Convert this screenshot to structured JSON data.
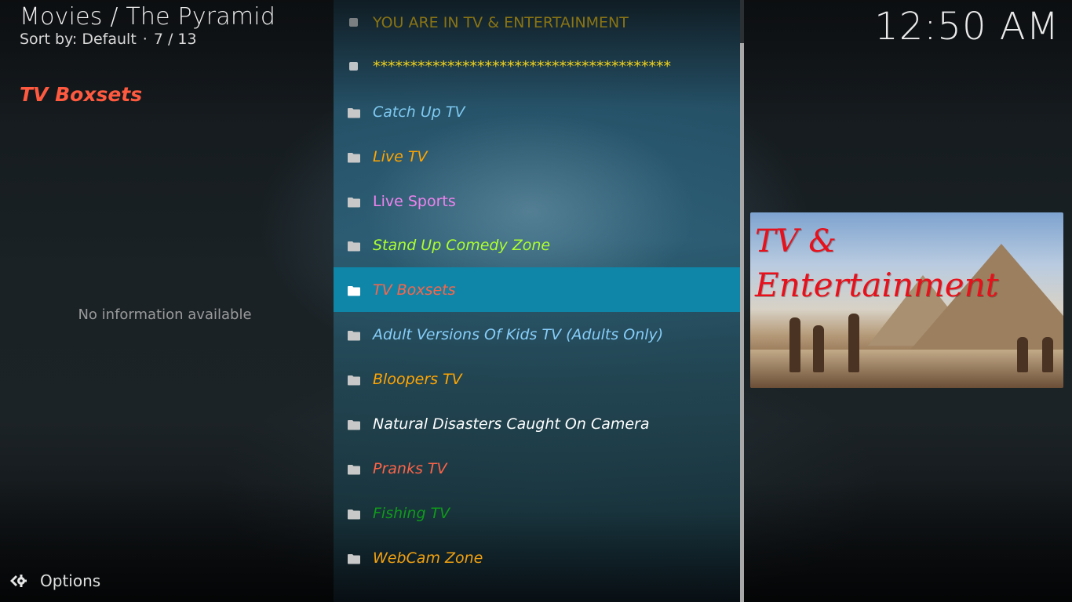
{
  "header": {
    "title": "Movies / The Pyramid",
    "sort_label": "Sort by: Default",
    "separator": "·",
    "position": "7 / 13"
  },
  "clock": "12:50 AM",
  "info_panel": {
    "selected_title": "TV Boxsets",
    "selected_title_color": "#ff5a40",
    "no_info": "No information available"
  },
  "list": {
    "focused_index": 6,
    "focus_color": "#0f86a8",
    "items": [
      {
        "label": "YOU ARE IN TV & ENTERTAINMENT",
        "icon": "bullet-icon",
        "color": "#8a7413",
        "italic": false
      },
      {
        "label": "****************************************",
        "icon": "bullet-icon",
        "color": "#f2d21a",
        "italic": false
      },
      {
        "label": "Catch Up TV",
        "icon": "folder-icon",
        "color": "#7ec8f0",
        "italic": true
      },
      {
        "label": "Live TV",
        "icon": "folder-icon",
        "color": "#ffa500",
        "italic": true
      },
      {
        "label": "Live Sports",
        "icon": "folder-icon",
        "color": "#ee82ee",
        "italic": false
      },
      {
        "label": "Stand Up Comedy Zone",
        "icon": "folder-icon",
        "color": "#adff2f",
        "italic": true
      },
      {
        "label": "TV Boxsets",
        "icon": "folder-icon",
        "color": "#ff6347",
        "italic": true
      },
      {
        "label": "Adult Versions Of Kids TV (Adults Only)",
        "icon": "folder-icon",
        "color": "#87cefa",
        "italic": true
      },
      {
        "label": "Bloopers TV",
        "icon": "folder-icon",
        "color": "#ffa500",
        "italic": true
      },
      {
        "label": "Natural Disasters Caught On Camera",
        "icon": "folder-icon",
        "color": "#ffffff",
        "italic": true
      },
      {
        "label": "Pranks TV",
        "icon": "folder-icon",
        "color": "#ff6347",
        "italic": true
      },
      {
        "label": "Fishing TV",
        "icon": "folder-icon",
        "color": "#0f9a1a",
        "italic": true
      },
      {
        "label": "WebCam Zone",
        "icon": "folder-icon",
        "color": "#f0a010",
        "italic": true
      }
    ]
  },
  "poster": {
    "line1": "TV &",
    "line2": "Entertainment"
  },
  "footer": {
    "options_label": "Options",
    "options_icon": "options-gear-icon"
  }
}
